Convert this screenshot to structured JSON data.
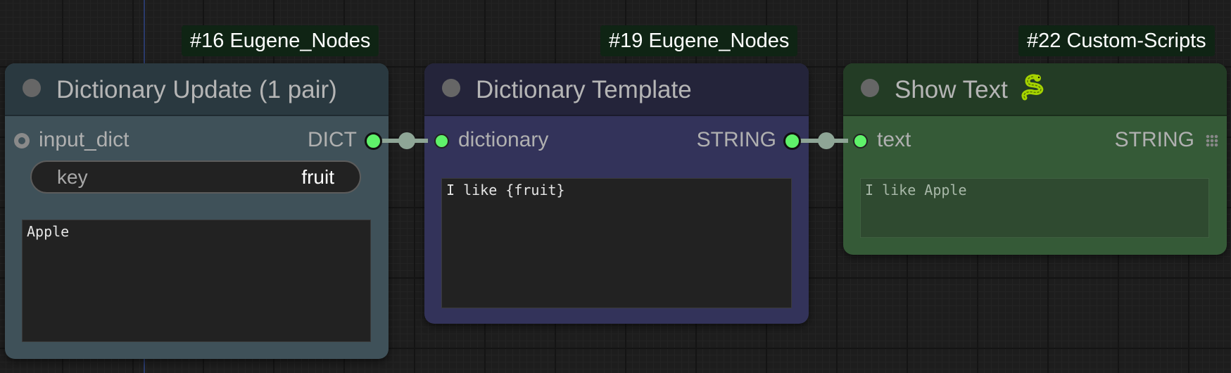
{
  "nodes": [
    {
      "badge": "#16 Eugene_Nodes",
      "title": "Dictionary Update (1 pair)",
      "input_label": "input_dict",
      "output_label": "DICT",
      "widget": {
        "name": "key",
        "value": "fruit"
      },
      "textarea_value": "Apple",
      "colors": {
        "body": "#3f5159",
        "title": "#2a3940"
      }
    },
    {
      "badge": "#19 Eugene_Nodes",
      "title": "Dictionary Template",
      "input_label": "dictionary",
      "output_label": "STRING",
      "textarea_value": "I like {fruit}",
      "colors": {
        "body": "#33335a",
        "title": "#24243a"
      }
    },
    {
      "badge": "#22 Custom-Scripts",
      "title": "Show Text",
      "title_icon": "snake-icon",
      "input_label": "text",
      "output_label": "STRING",
      "textarea_value": "I like Apple",
      "colors": {
        "body": "#355a37",
        "title": "#233c25"
      }
    }
  ],
  "link_color": "#8ea596",
  "slot_color": "#5ff26a"
}
